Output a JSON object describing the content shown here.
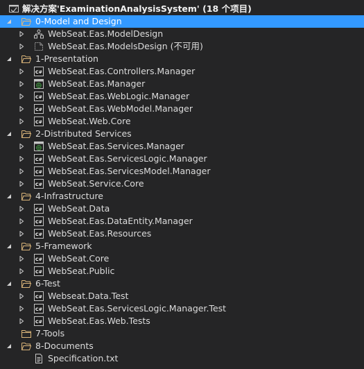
{
  "solution": {
    "label": "解决方案'ExaminationAnalysisSystem' (18 个项目)",
    "icon": "solution-icon"
  },
  "tree": [
    {
      "type": "folder",
      "label": "0-Model and Design",
      "expanded": true,
      "selected": true
    },
    {
      "type": "project",
      "label": "WebSeat.Eas.ModelDesign",
      "icon": "modeling-project-icon"
    },
    {
      "type": "project",
      "label": "WebSeat.Eas.ModelsDesign (不可用)",
      "icon": "unavailable-project-icon"
    },
    {
      "type": "folder",
      "label": "1-Presentation",
      "expanded": true
    },
    {
      "type": "project",
      "label": "WebSeat.Eas.Controllers.Manager",
      "icon": "csharp-project-icon"
    },
    {
      "type": "project",
      "label": "WebSeat.Eas.Manager",
      "icon": "web-project-icon"
    },
    {
      "type": "project",
      "label": "WebSeat.Eas.WebLogic.Manager",
      "icon": "csharp-project-icon"
    },
    {
      "type": "project",
      "label": "WebSeat.Eas.WebModel.Manager",
      "icon": "csharp-project-icon"
    },
    {
      "type": "project",
      "label": "WebSeat.Web.Core",
      "icon": "csharp-project-icon"
    },
    {
      "type": "folder",
      "label": "2-Distributed Services",
      "expanded": true
    },
    {
      "type": "project",
      "label": "WebSeat.Eas.Services.Manager",
      "icon": "web-project-icon"
    },
    {
      "type": "project",
      "label": "WebSeat.Eas.ServicesLogic.Manager",
      "icon": "csharp-project-icon"
    },
    {
      "type": "project",
      "label": "WebSeat.Eas.ServicesModel.Manager",
      "icon": "csharp-project-icon"
    },
    {
      "type": "project",
      "label": "WebSeat.Service.Core",
      "icon": "csharp-project-icon"
    },
    {
      "type": "folder",
      "label": "4-Infrastructure",
      "expanded": true
    },
    {
      "type": "project",
      "label": "WebSeat.Data",
      "icon": "csharp-project-icon"
    },
    {
      "type": "project",
      "label": "WebSeat.Eas.DataEntity.Manager",
      "icon": "csharp-project-icon"
    },
    {
      "type": "project",
      "label": "WebSeat.Eas.Resources",
      "icon": "csharp-project-icon"
    },
    {
      "type": "folder",
      "label": "5-Framework",
      "expanded": true
    },
    {
      "type": "project",
      "label": "WebSeat.Core",
      "icon": "csharp-project-icon"
    },
    {
      "type": "project",
      "label": "WebSeat.Public",
      "icon": "csharp-project-icon"
    },
    {
      "type": "folder",
      "label": "6-Test",
      "expanded": true
    },
    {
      "type": "project",
      "label": "Webseat.Data.Test",
      "icon": "csharp-project-icon"
    },
    {
      "type": "project",
      "label": "WebSeat.Eas.ServicesLogic.Manager.Test",
      "icon": "csharp-project-icon"
    },
    {
      "type": "project",
      "label": "WebSeat.Eas.Web.Tests",
      "icon": "csharp-project-icon"
    },
    {
      "type": "folder",
      "label": "7-Tools",
      "expanded": false,
      "empty": true
    },
    {
      "type": "folder",
      "label": "8-Documents",
      "expanded": true
    },
    {
      "type": "file",
      "label": "Specification.txt",
      "icon": "text-file-icon"
    }
  ],
  "colors": {
    "background": "#252526",
    "selection": "#3399ff",
    "text": "#dcdcdc",
    "csharp_badge": "#3f8f3f",
    "folder": "#dcb67a"
  }
}
